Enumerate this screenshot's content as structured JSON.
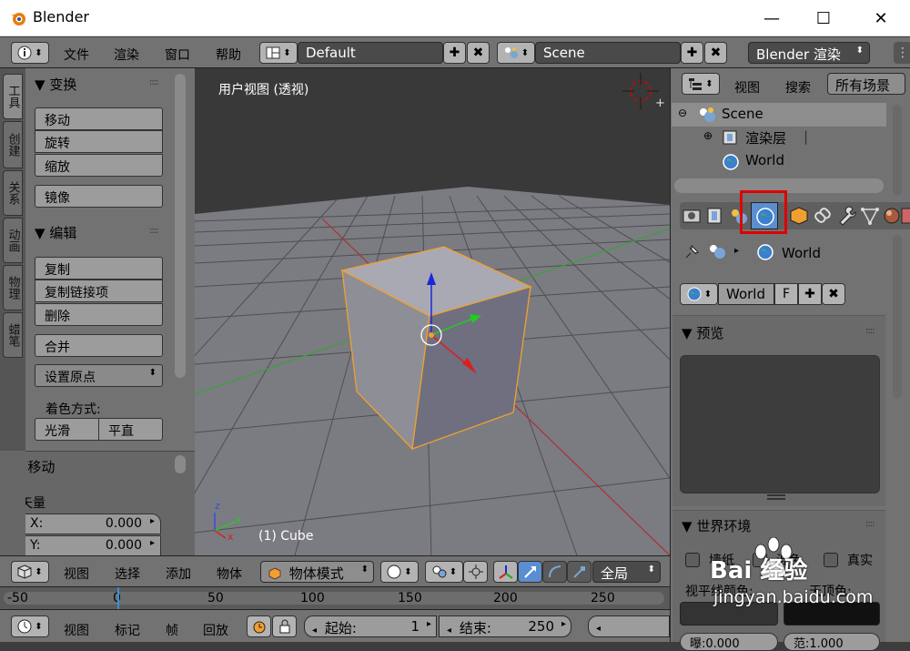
{
  "window": {
    "title": "Blender",
    "min": "—",
    "max": "☐",
    "close": "✕"
  },
  "topbar": {
    "menus": [
      "文件",
      "渲染",
      "窗口",
      "帮助"
    ],
    "layout": "Default",
    "scene": "Scene",
    "engine": "Blender 渲染"
  },
  "lefttabs": [
    "工具",
    "创建",
    "关系",
    "动画",
    "物理",
    "蜡笔"
  ],
  "toolpanel": {
    "transform_header": "变换",
    "transform_buttons": [
      "移动",
      "旋转",
      "缩放"
    ],
    "mirror": "镜像",
    "edit_header": "编辑",
    "edit_buttons": [
      "复制",
      "复制链接项",
      "删除"
    ],
    "join": "合并",
    "set_origin": "设置原点",
    "shading_label": "着色方式:",
    "smooth": "光滑",
    "flat": "平直",
    "op_header": "移动",
    "vector_label": "矢量",
    "x_label": "X:",
    "x_value": "0.000",
    "y_label": "Y:",
    "y_value": "0.000"
  },
  "viewport": {
    "label": "用户视图 (透视)",
    "object": "(1) Cube",
    "axis_z": "z",
    "axis_y": "y",
    "axis_x": "x"
  },
  "vpheader": {
    "menus": [
      "视图",
      "选择",
      "添加",
      "物体"
    ],
    "mode": "物体模式",
    "pivot": "全局"
  },
  "ruler": {
    "ticks": [
      "-50",
      "0",
      "50",
      "100",
      "150",
      "200",
      "250"
    ]
  },
  "tlheader": {
    "menus": [
      "视图",
      "标记",
      "帧",
      "回放"
    ],
    "start_label": "起始:",
    "start_value": "1",
    "end_label": "结束:",
    "end_value": "250"
  },
  "outliner": {
    "menus": [
      "视图",
      "搜索"
    ],
    "filter": "所有场景",
    "items": [
      "Scene",
      "渲染层",
      "World"
    ]
  },
  "props": {
    "breadcrumb": "World",
    "world_name": "World",
    "fake_user": "F",
    "preview_header": "预览",
    "world_header": "世界环境",
    "paper_sky": "墙纸",
    "blend_sky": "混色",
    "real_sky": "真实",
    "horizon_label": "视平线颜色:",
    "zenith_label": "天顶色:",
    "bottom_left": "曝:0.000",
    "bottom_right": "范:1.000"
  },
  "watermark": {
    "brand": "Bai 经验",
    "url": "jingyan.baidu.com"
  },
  "colors": {
    "highlight": "#e00000",
    "selection": "#f0a030"
  }
}
